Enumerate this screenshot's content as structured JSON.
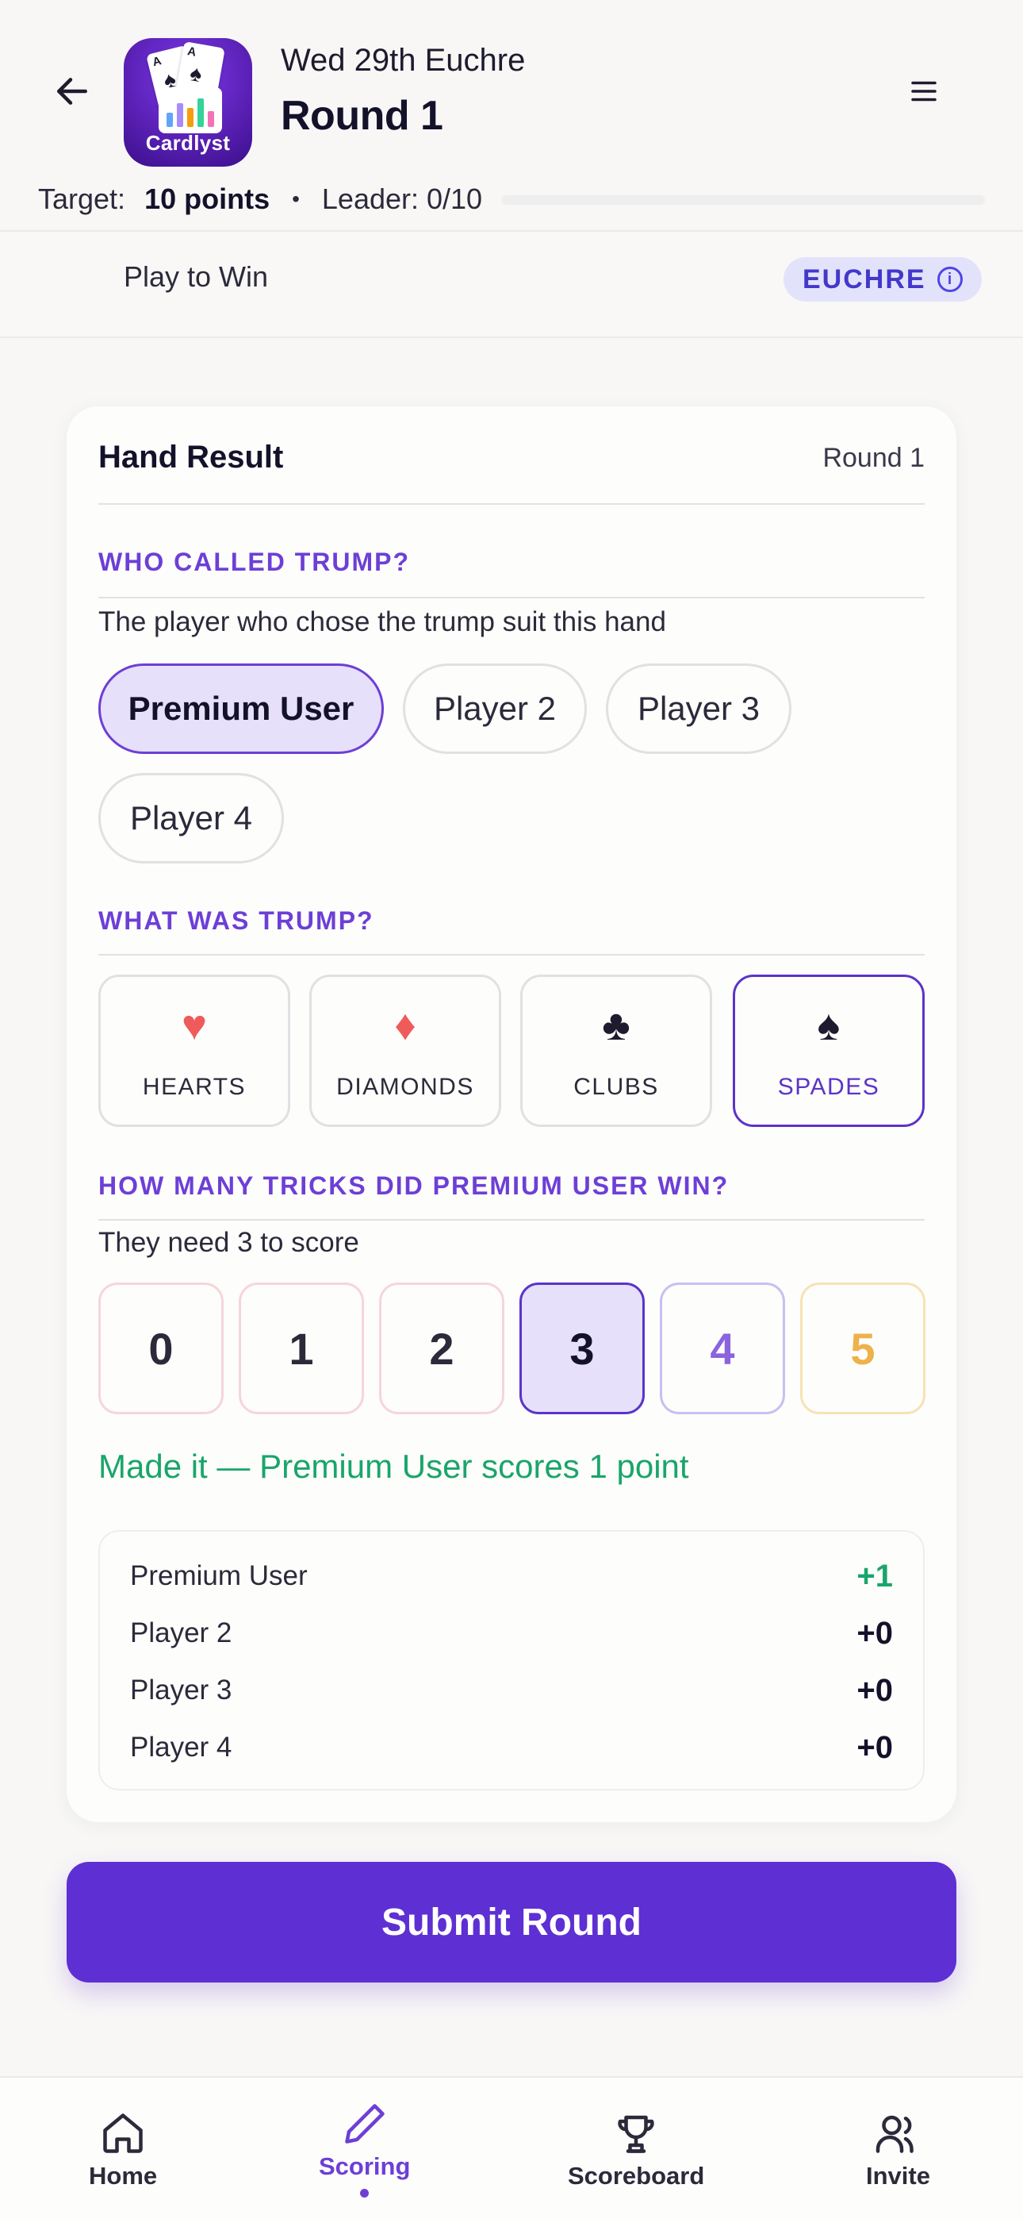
{
  "header": {
    "game_name": "Wed 29th Euchre",
    "round_title": "Round 1",
    "logo_text": "Cardlyst",
    "target_label": "Target:",
    "target_value": "10 points",
    "separator": "•",
    "leader_text": "Leader: 0/10",
    "leader_progress": 0.0
  },
  "subheader": {
    "mode": "Play to Win",
    "badge": "EUCHRE"
  },
  "card": {
    "title": "Hand Result",
    "round": "Round 1",
    "called": {
      "label": "WHO CALLED TRUMP?",
      "description": "The player who chose the trump suit this hand",
      "options": [
        "Premium User",
        "Player 2",
        "Player 3",
        "Player 4"
      ],
      "selected": "Premium User"
    },
    "trump": {
      "label": "WHAT WAS TRUMP?",
      "suits": [
        {
          "glyph": "♥",
          "label": "HEARTS",
          "color": "#ef5b5b"
        },
        {
          "glyph": "♦",
          "label": "DIAMONDS",
          "color": "#ef5b5b"
        },
        {
          "glyph": "♣",
          "label": "CLUBS",
          "color": "#1e1b2e"
        },
        {
          "glyph": "♠",
          "label": "SPADES",
          "color": "#1e1b2e"
        }
      ],
      "selected": "SPADES"
    },
    "tricks": {
      "label": "HOW MANY TRICKS DID PREMIUM USER WIN?",
      "description": "They need 3 to score",
      "options": [
        "0",
        "1",
        "2",
        "3",
        "4",
        "5"
      ],
      "selected": "3"
    },
    "result_message": "Made it — Premium User scores 1 point",
    "scores": [
      {
        "name": "Premium User",
        "points": "+1"
      },
      {
        "name": "Player 2",
        "points": "+0"
      },
      {
        "name": "Player 3",
        "points": "+0"
      },
      {
        "name": "Player 4",
        "points": "+0"
      }
    ]
  },
  "submit_label": "Submit Round",
  "nav": {
    "items": [
      {
        "label": "Home",
        "icon": "home-icon"
      },
      {
        "label": "Scoring",
        "icon": "pencil-icon"
      },
      {
        "label": "Scoreboard",
        "icon": "trophy-icon"
      },
      {
        "label": "Invite",
        "icon": "users-icon"
      }
    ],
    "active": "Scoring"
  },
  "colors": {
    "accent": "#6d3fd6",
    "button": "#5e2fd3",
    "success": "#1aa56a",
    "badge_bg": "#e2e3fb"
  }
}
